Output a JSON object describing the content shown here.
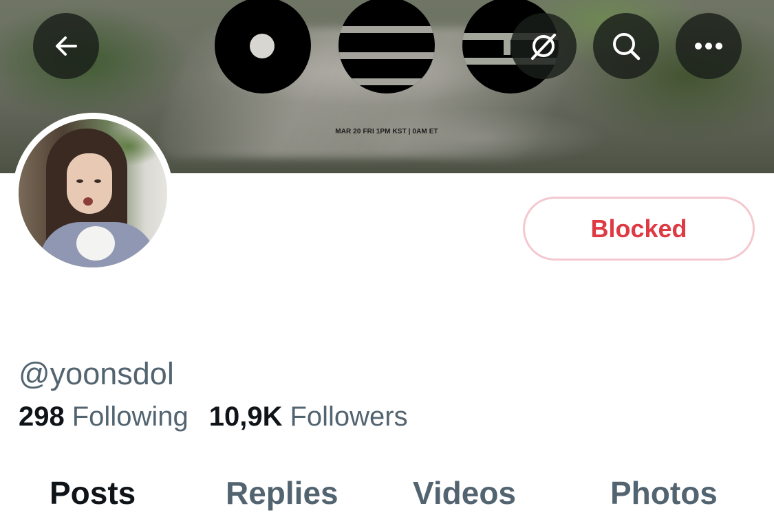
{
  "banner": {
    "caption": "MAR 20 FRI 1PM KST | 0AM ET"
  },
  "nav": {
    "back_icon": "arrow-left-icon",
    "grok_icon": "grok-icon",
    "search_icon": "search-icon",
    "more_icon": "more-horizontal-icon"
  },
  "profile": {
    "handle": "@yoonsdol",
    "following_count": "298",
    "following_label": "Following",
    "followers_count": "10,9K",
    "followers_label": "Followers"
  },
  "actions": {
    "blocked_label": "Blocked"
  },
  "tabs": [
    {
      "label": "Posts",
      "active": true
    },
    {
      "label": "Replies",
      "active": false
    },
    {
      "label": "Videos",
      "active": false
    },
    {
      "label": "Photos",
      "active": false
    }
  ],
  "colors": {
    "blocked_red": "#de3a43",
    "blocked_border": "#f4c8cf",
    "secondary_text": "#536471",
    "primary_text": "#0f1419"
  }
}
